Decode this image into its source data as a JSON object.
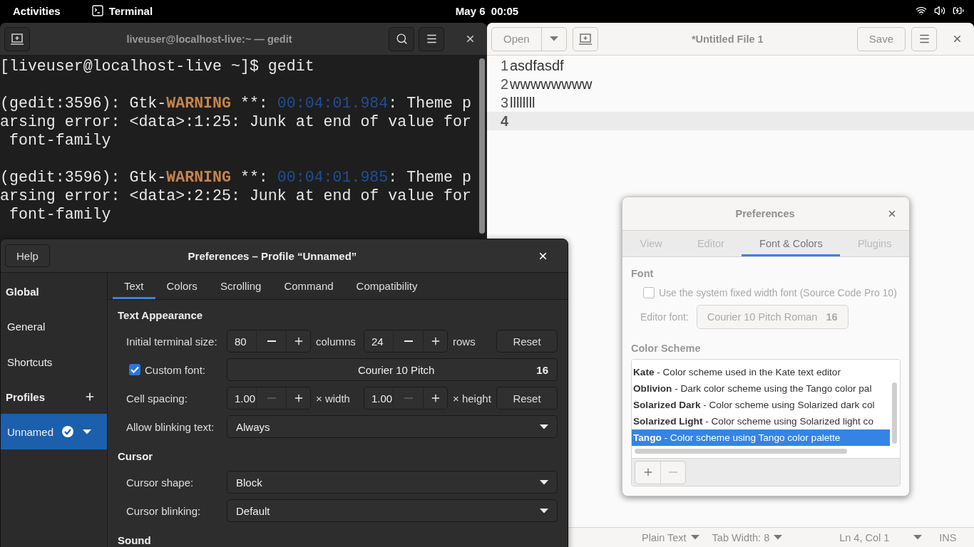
{
  "top_bar": {
    "activities": "Activities",
    "app_name": "Terminal",
    "clock": "May 6  00:05"
  },
  "terminal": {
    "title": "liveuser@localhost-live:~ — gedit",
    "blocks": [
      {
        "lines": [
          {
            "segments": [
              {
                "kind": "plain",
                "text": "[liveuser@localhost-live ~]$ gedit"
              }
            ]
          }
        ]
      },
      {
        "lines": [
          {
            "segments": [
              {
                "kind": "plain",
                "text": "(gedit:3596): Gtk-"
              },
              {
                "kind": "warning",
                "text": "WARNING"
              },
              {
                "kind": "plain",
                "text": " **: "
              },
              {
                "kind": "time",
                "text": "00:04:01.984"
              },
              {
                "kind": "plain",
                "text": ": Theme p"
              }
            ]
          },
          {
            "segments": [
              {
                "kind": "plain",
                "text": "arsing error: <data>:1:25: Junk at end of value for"
              }
            ]
          },
          {
            "segments": [
              {
                "kind": "plain",
                "text": " font-family"
              }
            ]
          }
        ]
      },
      {
        "lines": [
          {
            "segments": [
              {
                "kind": "plain",
                "text": "(gedit:3596): Gtk-"
              },
              {
                "kind": "warning",
                "text": "WARNING"
              },
              {
                "kind": "plain",
                "text": " **: "
              },
              {
                "kind": "time",
                "text": "00:04:01.985"
              },
              {
                "kind": "plain",
                "text": ": Theme p"
              }
            ]
          },
          {
            "segments": [
              {
                "kind": "plain",
                "text": "arsing error: <data>:2:25: Junk at end of value for"
              }
            ]
          },
          {
            "segments": [
              {
                "kind": "plain",
                "text": " font-family"
              }
            ]
          }
        ]
      }
    ]
  },
  "gedit": {
    "open_button": "Open",
    "title": "*Untitled File 1",
    "save_button": "Save",
    "lines": [
      {
        "number": "1",
        "text": "asdfasdf",
        "current": false
      },
      {
        "number": "2",
        "text": "wwwwwwww",
        "current": false
      },
      {
        "number": "3",
        "text": "llllllll",
        "current": false
      },
      {
        "number": "4",
        "current": true
      }
    ],
    "status_bar": {
      "language": "Plain Text",
      "tab_width": "Tab Width: 8",
      "position": "Ln 4, Col 1",
      "mode": "INS"
    }
  },
  "terminal_preferences": {
    "help_button": "Help",
    "title": "Preferences – Profile “Unnamed”",
    "sidebar": [
      {
        "kind": "heading",
        "label": "Global"
      },
      {
        "kind": "item",
        "label": "General",
        "selected": false
      },
      {
        "kind": "item",
        "label": "Shortcuts",
        "selected": false
      },
      {
        "kind": "heading_add",
        "label": "Profiles"
      },
      {
        "kind": "profile",
        "label": "Unnamed",
        "selected": true
      }
    ],
    "tabs": [
      {
        "label": "Text",
        "selected": true
      },
      {
        "label": "Colors",
        "selected": false
      },
      {
        "label": "Scrolling",
        "selected": false
      },
      {
        "label": "Command",
        "selected": false
      },
      {
        "label": "Compatibility",
        "selected": false
      }
    ],
    "sections": [
      {
        "title": "Text Appearance",
        "rows": [
          {
            "kind": "spin_pair",
            "label": "Initial terminal size:",
            "spinners": [
              {
                "value": "80",
                "unit": "columns",
                "minus_disabled": false
              },
              {
                "value": "24",
                "unit": "rows",
                "minus_disabled": false
              }
            ],
            "reset": "Reset"
          },
          {
            "kind": "font",
            "label": "Custom font:",
            "checked": true,
            "font": "Courier 10 Pitch",
            "size": "16"
          },
          {
            "kind": "spin_pair",
            "label": "Cell spacing:",
            "spinners": [
              {
                "value": "1.00",
                "unit": "× width",
                "minus_disabled": true
              },
              {
                "value": "1.00",
                "unit": "× height",
                "minus_disabled": true
              }
            ],
            "reset": "Reset"
          },
          {
            "kind": "dropdown",
            "label": "Allow blinking text:",
            "value": "Always"
          }
        ]
      },
      {
        "title": "Cursor",
        "rows": [
          {
            "kind": "dropdown",
            "label": "Cursor shape:",
            "value": "Block"
          },
          {
            "kind": "dropdown",
            "label": "Cursor blinking:",
            "value": "Default"
          }
        ]
      },
      {
        "title": "Sound"
      }
    ]
  },
  "gedit_preferences": {
    "title": "Preferences",
    "tabs": [
      {
        "label": "View",
        "selected": false
      },
      {
        "label": "Editor",
        "selected": false
      },
      {
        "label": "Font & Colors",
        "selected": true
      },
      {
        "label": "Plugins",
        "selected": false
      }
    ],
    "font_heading": "Font",
    "system_font": {
      "label": "Use the system fixed width font (Source Code Pro 10)",
      "checked": false
    },
    "editor_font_label": "Editor font:",
    "editor_font": "Courier 10 Pitch Roman",
    "editor_font_size": "16",
    "scheme_heading": "Color Scheme",
    "schemes": [
      {
        "text": "**Kate** - Color scheme used in the Kate text editor",
        "selected": false
      },
      {
        "text": "**Oblivion** - Dark color scheme using the Tango color pal",
        "selected": false
      },
      {
        "text": "**Solarized Dark** - Color scheme using Solarized dark col",
        "selected": false
      },
      {
        "text": "**Solarized Light** - Color scheme using Solarized light co",
        "selected": false
      },
      {
        "text": "**Tango** - Color scheme using Tango color palette",
        "selected": true
      }
    ]
  }
}
